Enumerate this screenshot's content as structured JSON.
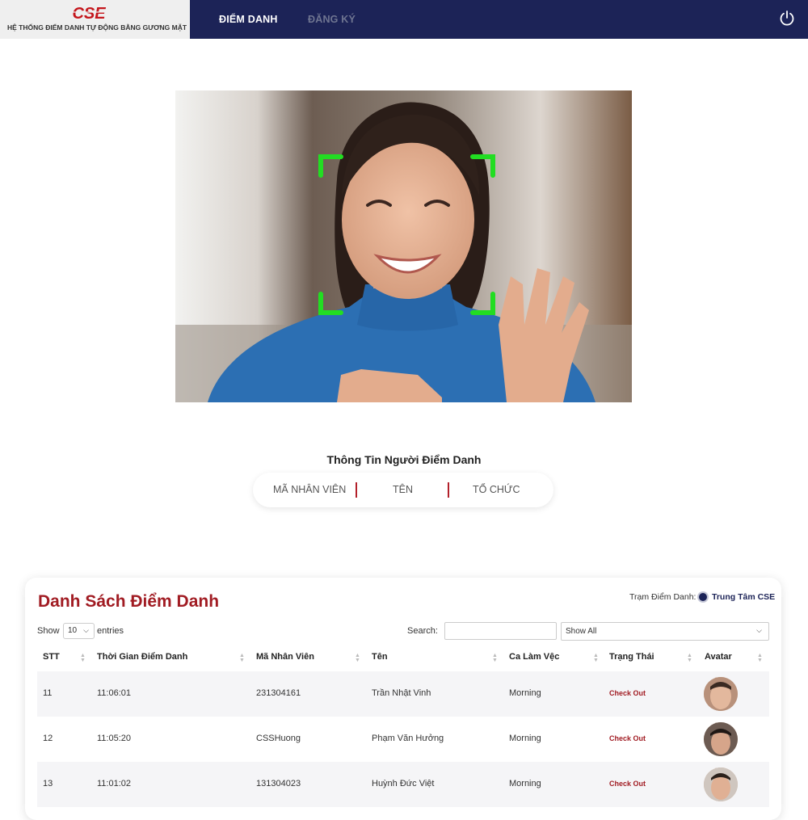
{
  "header": {
    "logo_text": "CSE",
    "subtitle": "HỆ THỐNG ĐIỂM DANH TỰ ĐỘNG BẰNG GƯƠNG MẶT",
    "nav": [
      {
        "label": "ĐIỂM DANH",
        "active": true
      },
      {
        "label": "ĐĂNG KÝ",
        "active": false
      }
    ],
    "power_icon": "power-icon"
  },
  "camera": {
    "scan_frame_color": "#22dd22"
  },
  "info": {
    "title": "Thông Tin Người Điểm Danh",
    "fields": [
      "MÃ NHÂN VIÊN",
      "TÊN",
      "TỔ CHỨC"
    ]
  },
  "attendance": {
    "title": "Danh Sách Điểm Danh",
    "station_label": "Trạm Điểm Danh:",
    "station_name": "Trung Tâm CSE",
    "show_label": "Show",
    "show_value": "10",
    "entries_label": "entries",
    "search_label": "Search:",
    "search_value": "",
    "filter_value": "Show All",
    "columns": [
      "STT",
      "Thời Gian Điểm Danh",
      "Mã Nhân Viên",
      "Tên",
      "Ca Làm Vệc",
      "Trạng Thái",
      "Avatar"
    ],
    "rows": [
      {
        "stt": "11",
        "time": "11:06:01",
        "code": "231304161",
        "name": "Trần Nhật Vinh",
        "shift": "Morning",
        "status": "Check Out"
      },
      {
        "stt": "12",
        "time": "11:05:20",
        "code": "CSSHuong",
        "name": "Phạm Văn Hưởng",
        "shift": "Morning",
        "status": "Check Out"
      },
      {
        "stt": "13",
        "time": "11:01:02",
        "code": "131304023",
        "name": "Huỳnh Đức Việt",
        "shift": "Morning",
        "status": "Check Out"
      }
    ]
  },
  "colors": {
    "navbar": "#1c2357",
    "accent_red": "#a11c23"
  }
}
